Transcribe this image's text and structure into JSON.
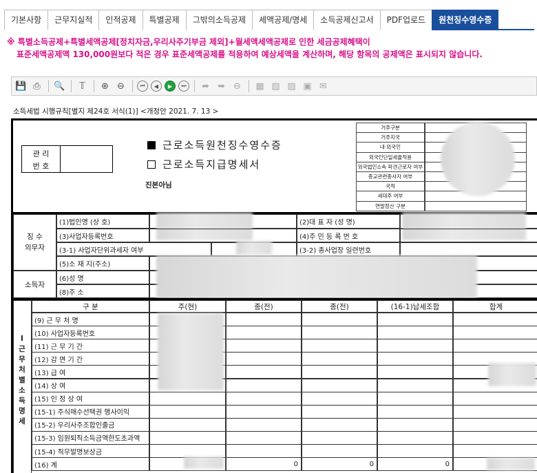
{
  "tabs": [
    "기본사항",
    "근무지실적",
    "인적공제",
    "특별공제",
    "그밖의소득공제",
    "세액공제/명세",
    "소득공제신고서",
    "PDF업로드",
    "원천징수영수증"
  ],
  "active_tab": 8,
  "notice": {
    "line1": "※ 특별소득공제+특별세액공제[정치자금,우리사주기부금 제외]+월세액세액공제로 인한 세금공제혜택이",
    "line2": "표준세액공제액 130,000원보다 적은 경우 표준세액공제를 적용하여 예상세액을 계산하며, 해당 항목의 공제액은 표시되지 않습니다."
  },
  "toolbar": {
    "icons": [
      "save-icon",
      "print-icon",
      "search-icon",
      "text-cursor-icon",
      "zoom-in-icon",
      "zoom-out-icon",
      "first-page-icon",
      "prev-page-icon",
      "next-page-icon",
      "last-page-icon",
      "export-icon",
      "import-icon",
      "remove-icon",
      "excel-icon",
      "word-icon",
      "hwp-icon",
      "image-icon",
      "mail-icon"
    ]
  },
  "form_reference": "소득세법 시행규칙[별지 제24호 서식(1)] <개정안 2021. 7. 13 >",
  "header": {
    "manage_label": "관 리",
    "number_label": "번 호",
    "title1": "근로소득원천징수영수증",
    "title2": "근로소득지급명세서",
    "copy_label": "진본아님",
    "side_rows": [
      "거주구분",
      "거주지국",
      "내·외국인",
      "외국인단일세율적용",
      "외국법인소속 파견근로자 여부",
      "종교관련종사자 여부",
      "국적",
      "세대주 여부",
      "연말정산 구분"
    ]
  },
  "payer": {
    "group_label_1": "징 수",
    "group_label_2": "의무자",
    "corp_name": "(1)법인명 (상 호)",
    "biz_no": "(3)사업자등록번호",
    "unit_tax": "(3-1) 사업자단위과세자 여부",
    "address": "(5)소 재 지(주소)",
    "ceo": "(2)대 표 자 (성   명)",
    "reg_no": "(4)주 민 등 록 번 호",
    "branch_no": "(3-2) 종사업장 일련번호"
  },
  "earner": {
    "group_label": "소득자",
    "name": "(6)성         명",
    "address": "(8)주         소"
  },
  "income": {
    "vertical_label": "I근무처별소득명세",
    "columns": [
      "구   분",
      "주(현)",
      "종(전)",
      "종(전)",
      "(16-1)납세조합",
      "합계"
    ],
    "rows": [
      "(9) 근 무 처 명",
      "(10) 사업자등록번호",
      "(11) 근 무 기 간",
      "(12) 감 면 기 간",
      "(13) 급          여",
      "(14) 상          여",
      "(15) 인 정 상 여",
      "(15-1) 주식매수선택권 행사이익",
      "(15-2) 우리사주조합인출금",
      "(15-3) 임원퇴직소득금액한도초과액",
      "(15-4) 직무발명보상금",
      "(16)          계"
    ],
    "total_values": [
      "0",
      "0",
      "0"
    ]
  }
}
